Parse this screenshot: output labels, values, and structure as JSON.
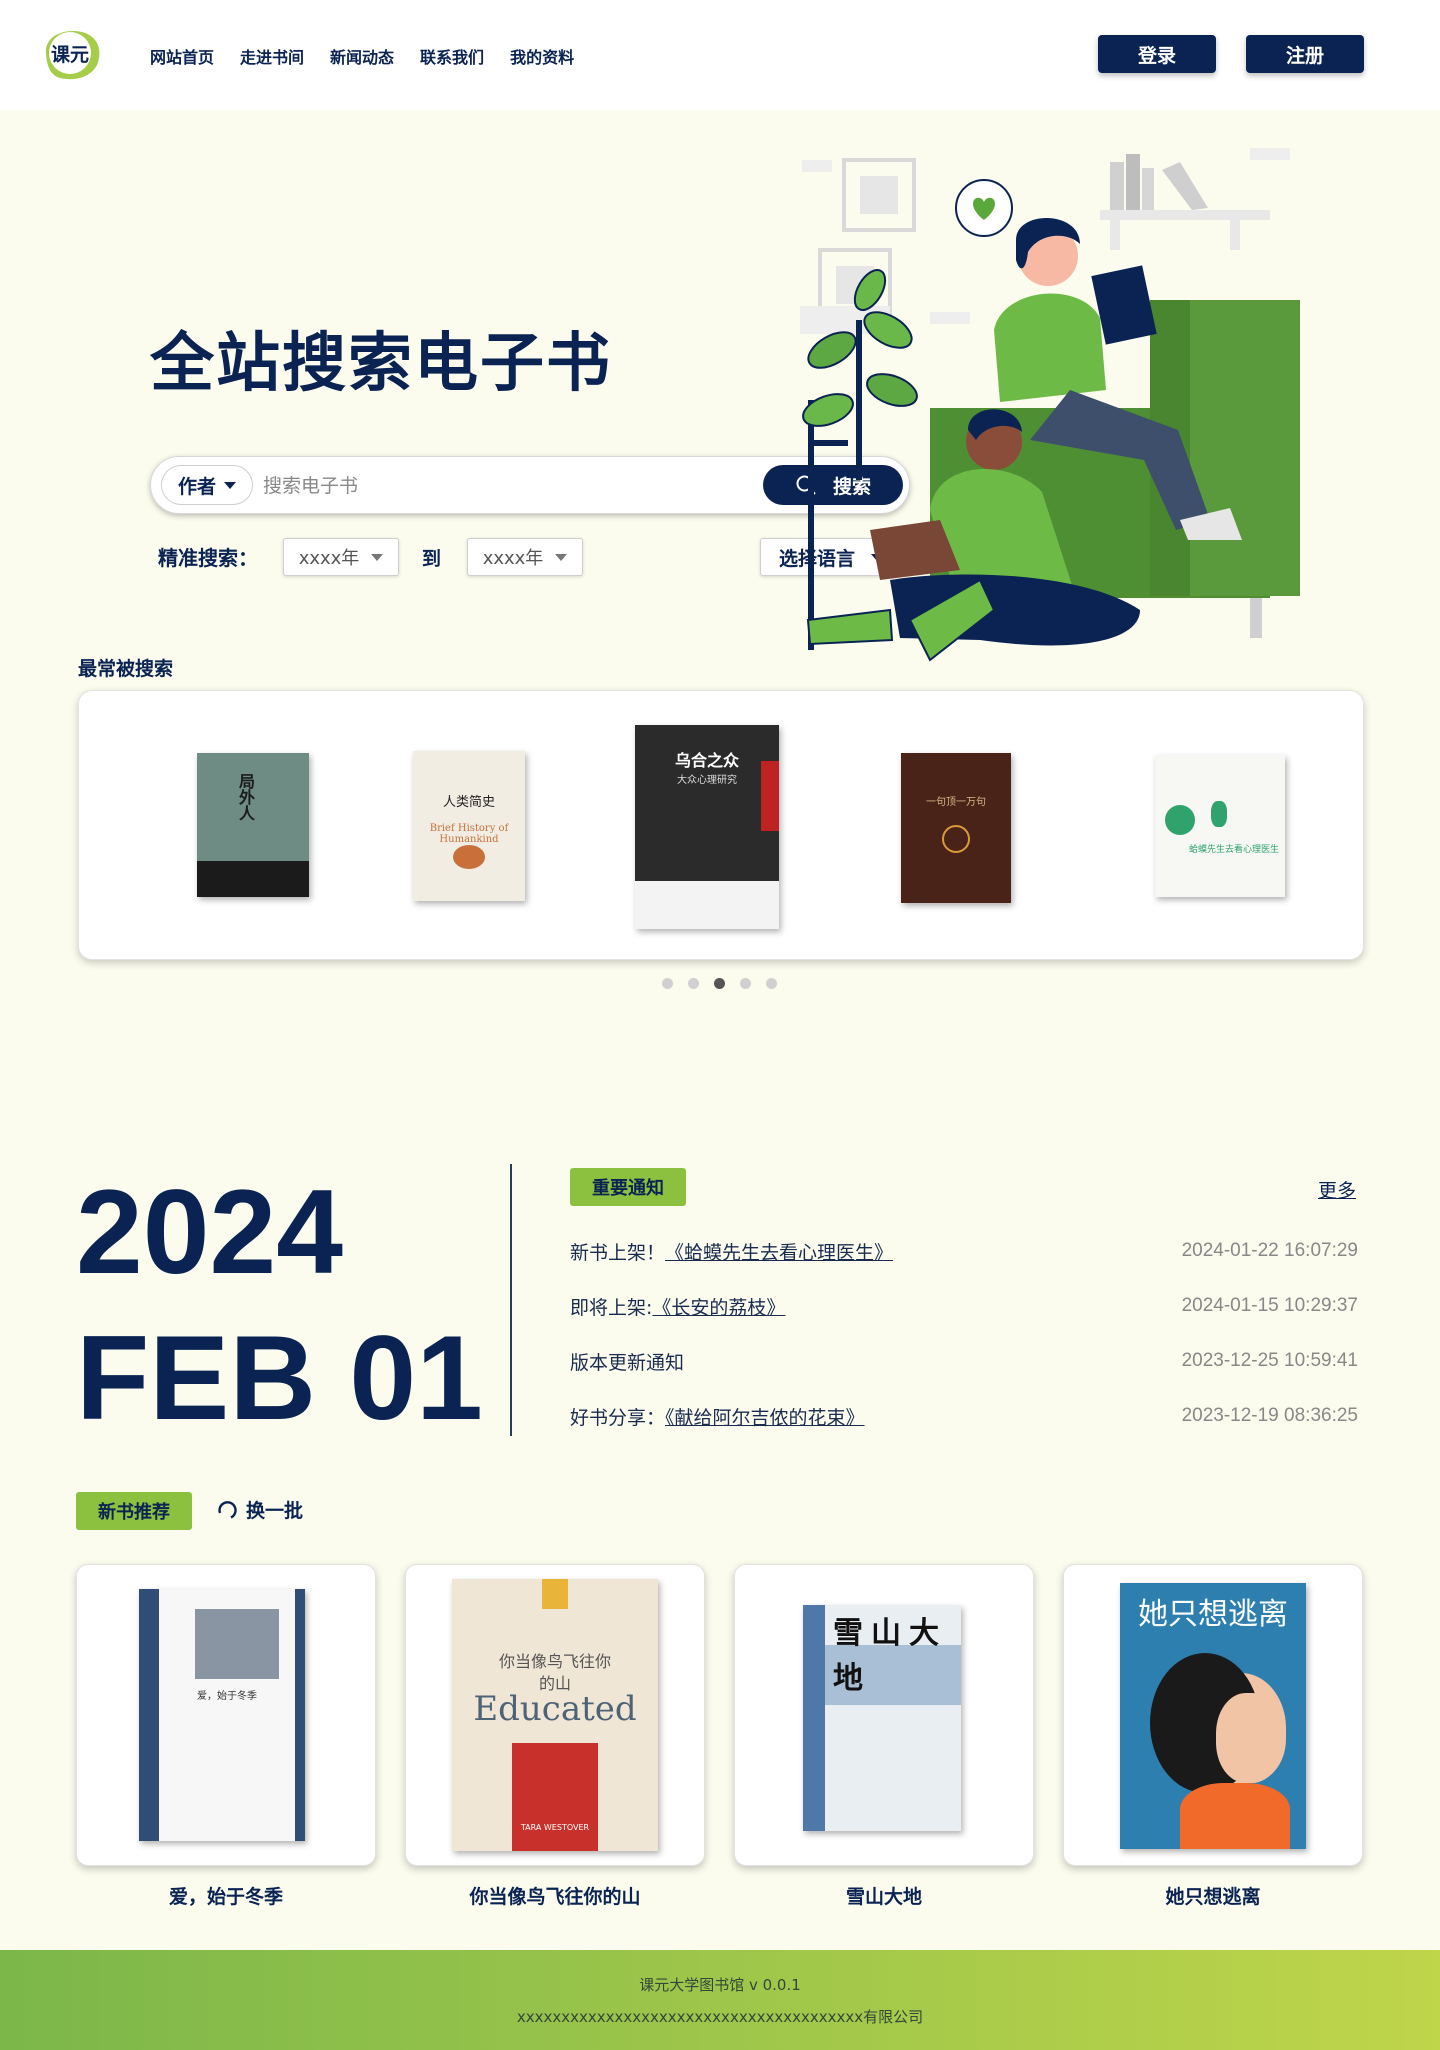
{
  "colors": {
    "brand_navy": "#0b2353",
    "accent_green": "#8cc13f",
    "page_bg": "#fbfcee"
  },
  "header": {
    "logo_text": "课元",
    "nav": [
      "网站首页",
      "走进书间",
      "新闻动态",
      "联系我们",
      "我的资料"
    ],
    "login_label": "登录",
    "register_label": "注册"
  },
  "hero": {
    "title": "全站搜索电子书",
    "search": {
      "field_selected": "作者",
      "placeholder": "搜索电子书",
      "button_label": "搜索",
      "icon": "search-icon"
    },
    "filters": {
      "label": "精准搜索：",
      "from_year": "xxxx年",
      "to_label": "到",
      "to_year": "xxxx年",
      "language": "选择语言"
    }
  },
  "popular": {
    "label": "最常被搜索",
    "books": [
      {
        "title": "局外人",
        "cover_color": "#6e8c84"
      },
      {
        "title": "人类简史",
        "subtitle": "Brief History of Humankind",
        "cover_color": "#f2ede2"
      },
      {
        "title": "乌合之众",
        "subtitle": "大众心理研究",
        "cover_color": "#2b2b2b"
      },
      {
        "title": "一句顶一万句",
        "cover_color": "#4a2318"
      },
      {
        "title": "蛤蟆先生去看心理医生",
        "cover_color": "#f7f7f4"
      }
    ],
    "pages": 5,
    "active_page": 3
  },
  "date": {
    "year": "2024",
    "month_day": "FEB 01"
  },
  "notices": {
    "badge": "重要通知",
    "more": "更多",
    "items": [
      {
        "prefix": "新书上架！",
        "link": "《蛤蟆先生去看心理医生》",
        "date": "2024-01-22 16:07:29"
      },
      {
        "prefix": "即将上架:",
        "link": "《长安的荔枝》",
        "date": "2024-01-15 10:29:37"
      },
      {
        "prefix": "版本更新通知",
        "link": "",
        "date": "2023-12-25 10:59:41"
      },
      {
        "prefix": "好书分享：",
        "link": "《献给阿尔吉侬的花束》",
        "date": "2023-12-19 08:36:25"
      }
    ]
  },
  "new_books": {
    "badge": "新书推荐",
    "refresh_label": "换一批",
    "items": [
      {
        "title": "爱，始于冬季",
        "cover_text": "爱，始于冬季",
        "cover_color": "#2f4d75"
      },
      {
        "title": "你当像鸟飞往你的山",
        "cover_text": "你当像鸟飞往你的山",
        "cover_sub": "Educated",
        "cover_author": "TARA WESTOVER",
        "cover_color": "#efe6d6"
      },
      {
        "title": "雪山大地",
        "cover_text": "雪山大地",
        "cover_color": "#e9eef3"
      },
      {
        "title": "她只想逃离",
        "cover_text": "她只想逃离",
        "cover_color": "#2d7fb0"
      }
    ]
  },
  "footer": {
    "line1": "课元大学图书馆 v 0.0.1",
    "line2": "xxxxxxxxxxxxxxxxxxxxxxxxxxxxxxxxxxxxxxx有限公司"
  }
}
